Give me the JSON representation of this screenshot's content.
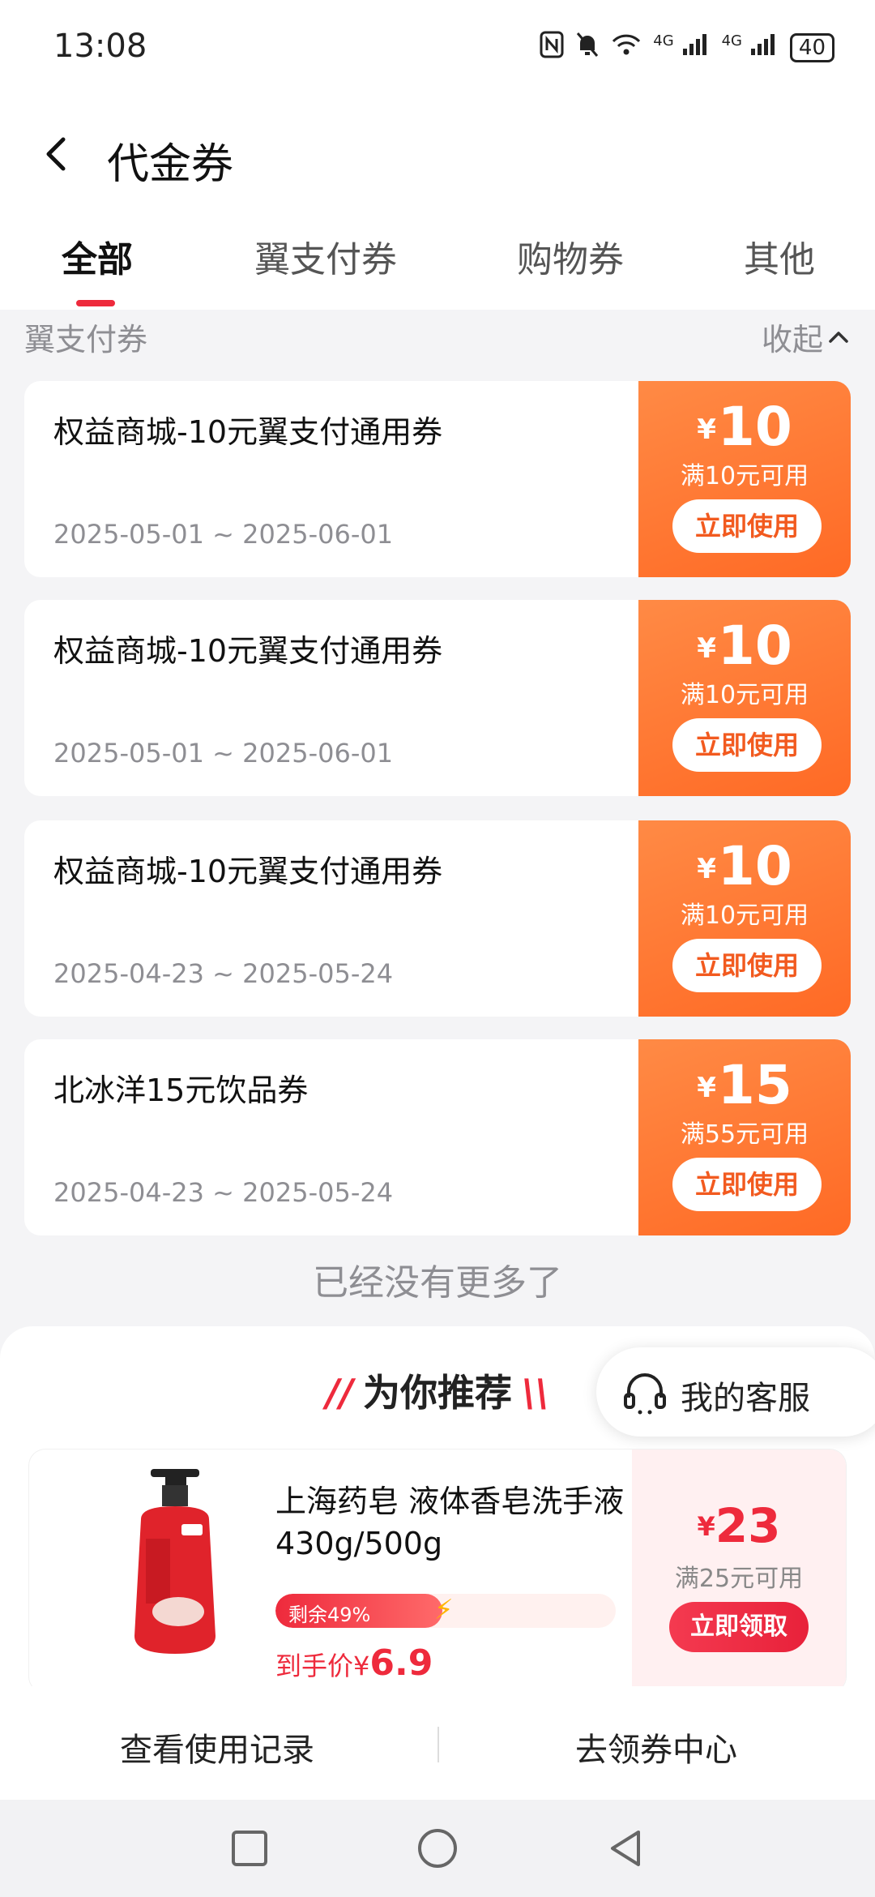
{
  "status_bar": {
    "time": "13:08",
    "signal_1": "4G",
    "signal_2": "4G",
    "battery": "40"
  },
  "header": {
    "title": "代金券"
  },
  "tabs": [
    {
      "label": "全部",
      "active": true
    },
    {
      "label": "翼支付券",
      "active": false
    },
    {
      "label": "购物券",
      "active": false
    },
    {
      "label": "其他",
      "active": false
    }
  ],
  "section": {
    "title": "翼支付券",
    "collapse_label": "收起"
  },
  "coupons": [
    {
      "name": "权益商城-10元翼支付通用券",
      "date": "2025-05-01 ~ 2025-06-01",
      "currency": "¥",
      "amount": "10",
      "condition": "满10元可用",
      "button": "立即使用"
    },
    {
      "name": "权益商城-10元翼支付通用券",
      "date": "2025-05-01 ~ 2025-06-01",
      "currency": "¥",
      "amount": "10",
      "condition": "满10元可用",
      "button": "立即使用"
    },
    {
      "name": "权益商城-10元翼支付通用券",
      "date": "2025-04-23 ~ 2025-05-24",
      "currency": "¥",
      "amount": "10",
      "condition": "满10元可用",
      "button": "立即使用"
    },
    {
      "name": "北冰洋15元饮品券",
      "date": "2025-04-23 ~ 2025-05-24",
      "currency": "¥",
      "amount": "15",
      "condition": "满55元可用",
      "button": "立即使用"
    }
  ],
  "no_more": "已经没有更多了",
  "recommend": {
    "title": "为你推荐",
    "service_label": "我的客服",
    "product": {
      "title": "上海药皂 液体香皂洗手液430g/500g",
      "stock_label": "剩余49%",
      "stock_fraction": 0.49,
      "final_price_label": "到手价",
      "currency": "¥",
      "final_price": "6.9",
      "coupon_amount": "23",
      "coupon_condition": "满25元可用",
      "claim_button": "立即领取"
    }
  },
  "bottom_bar": {
    "history_label": "查看使用记录",
    "center_label": "去领券中心"
  },
  "colors": {
    "accent": "#ee2a3c",
    "coupon_orange": "#ff7a35"
  }
}
